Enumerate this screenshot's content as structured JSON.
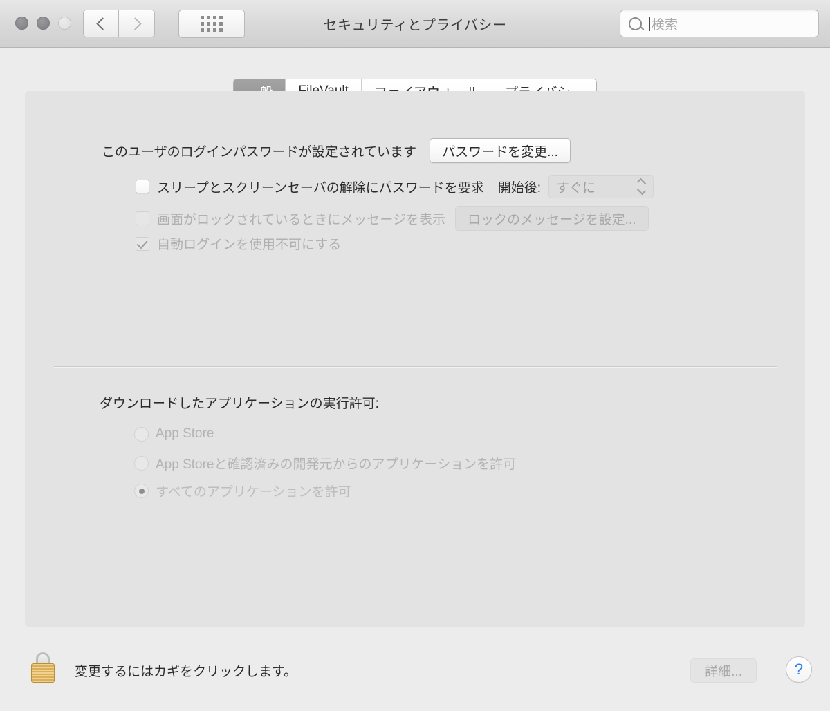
{
  "window": {
    "title": "セキュリティとプライバシー",
    "traffic_lights": [
      "close",
      "minimize",
      "zoom"
    ],
    "nav": {
      "back_icon": "chevron-left-icon",
      "forward_icon": "chevron-right-icon"
    },
    "grid_button_icon": "grid-apps-icon",
    "search": {
      "placeholder": "検索",
      "value": "",
      "icon": "search-icon",
      "focused": true
    }
  },
  "tabs": [
    {
      "label": "一般",
      "selected": true
    },
    {
      "label": "FileVault",
      "selected": false
    },
    {
      "label": "ファイアウォール",
      "selected": false
    },
    {
      "label": "プライバシー",
      "selected": false
    }
  ],
  "general": {
    "password_status": "このユーザのログインパスワードが設定されています",
    "change_password_button": "パスワードを変更...",
    "require_password": {
      "label": "スリープとスクリーンセーバの解除にパスワードを要求",
      "checked": false,
      "enabled": true
    },
    "after_label": "開始後:",
    "delay_popup": {
      "value": "すぐに",
      "enabled": false
    },
    "show_message": {
      "label": "画面がロックされているときにメッセージを表示",
      "checked": false,
      "enabled": false
    },
    "set_lock_message_button": {
      "label": "ロックのメッセージを設定...",
      "enabled": false
    },
    "disable_auto_login": {
      "label": "自動ログインを使用不可にする",
      "checked": true,
      "enabled": false
    }
  },
  "gatekeeper": {
    "heading": "ダウンロードしたアプリケーションの実行許可:",
    "options": [
      {
        "label": "App Store",
        "selected": false,
        "enabled": false
      },
      {
        "label": "App Storeと確認済みの開発元からのアプリケーションを許可",
        "selected": false,
        "enabled": false
      },
      {
        "label": "すべてのアプリケーションを許可",
        "selected": true,
        "enabled": false
      }
    ]
  },
  "footer": {
    "lock_icon": "padlock-locked-icon",
    "lock_caption": "変更するにはカギをクリックします。",
    "advanced_button": {
      "label": "詳細...",
      "enabled": false
    },
    "help_button": {
      "label": "?"
    }
  },
  "colors": {
    "window_background": "#ececec",
    "panel_background": "#e3e3e3",
    "selected_tab": "#979797",
    "help_blue": "#2a7df0",
    "lock_gold": "#d9ae5c"
  }
}
